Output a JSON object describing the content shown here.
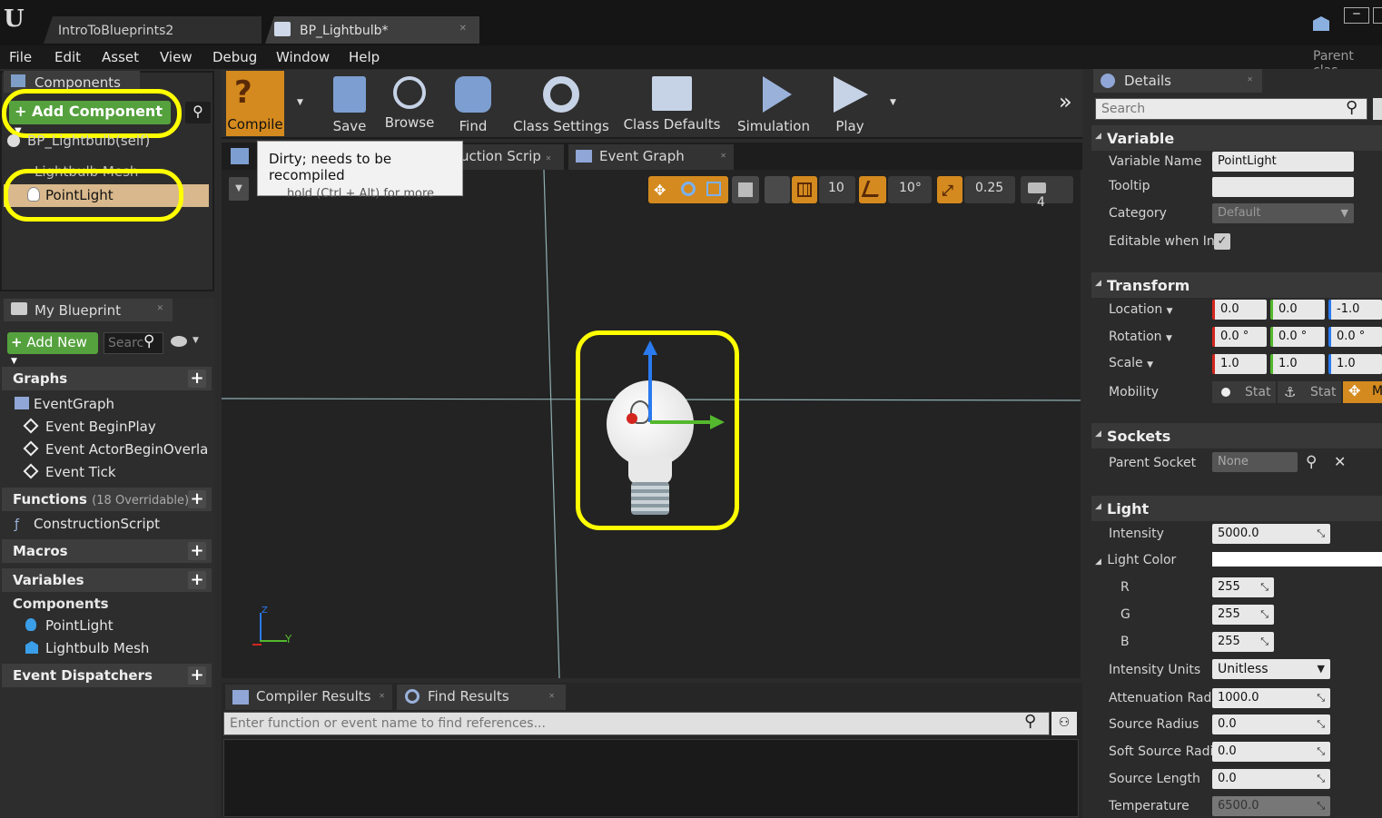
{
  "window": {
    "tabs": [
      "IntroToBlueprints2",
      "BP_Lightbulb*"
    ],
    "parent_class": "Parent clas",
    "logo": "U"
  },
  "menu": [
    "File",
    "Edit",
    "Asset",
    "View",
    "Debug",
    "Window",
    "Help"
  ],
  "components": {
    "title": "Components",
    "add_button": "+ Add Component",
    "self_item": "BP_Lightbulb(self)",
    "mesh_item": "Lightbulb Mesh",
    "selected_item": "PointLight"
  },
  "toolbar": {
    "items": [
      "Compile",
      "Save",
      "Browse",
      "Find",
      "Class Settings",
      "Class Defaults",
      "Simulation",
      "Play"
    ]
  },
  "tooltip": {
    "title": "Dirty; needs to be recompiled",
    "subtitle": "hold (Ctrl + Alt) for more"
  },
  "editor_tabs": [
    "uction Scrip",
    "Event Graph"
  ],
  "viewport": {
    "grid_snap": "10",
    "rotation_snap": "10°",
    "scale_snap": "0.25",
    "camera_speed": "4",
    "axis_y": "Y",
    "axis_z": "Z"
  },
  "my_blueprint": {
    "title": "My Blueprint",
    "add_new": "Add New",
    "search_placeholder": "Searc",
    "sections": {
      "graphs": "Graphs",
      "functions": "Functions",
      "functions_count": "(18 Overridable)",
      "macros": "Macros",
      "variables": "Variables",
      "components": "Components",
      "event_dispatchers": "Event Dispatchers"
    },
    "graph_items": [
      "EventGraph",
      "Event BeginPlay",
      "Event ActorBeginOverla",
      "Event Tick"
    ],
    "function_items": [
      "ConstructionScript"
    ],
    "component_items": [
      "PointLight",
      "Lightbulb Mesh"
    ]
  },
  "bottom": {
    "tabs": [
      "Compiler Results",
      "Find Results"
    ],
    "find_placeholder": "Enter function or event name to find references..."
  },
  "details": {
    "title": "Details",
    "search_placeholder": "Search",
    "variable": {
      "section": "Variable",
      "name_label": "Variable Name",
      "name_value": "PointLight",
      "tooltip_label": "Tooltip",
      "category_label": "Category",
      "category_value": "Default",
      "editable_label": "Editable when Inl"
    },
    "transform": {
      "section": "Transform",
      "location_label": "Location",
      "location": [
        "0.0",
        "0.0",
        "-1.0"
      ],
      "rotation_label": "Rotation",
      "rotation": [
        "0.0 °",
        "0.0 °",
        "0.0 °"
      ],
      "scale_label": "Scale",
      "scale": [
        "1.0",
        "1.0",
        "1.0"
      ],
      "mobility_label": "Mobility",
      "mobility_options": [
        "Stat",
        "Stat",
        "M"
      ]
    },
    "sockets": {
      "section": "Sockets",
      "parent_label": "Parent Socket",
      "parent_value": "None"
    },
    "light": {
      "section": "Light",
      "intensity_label": "Intensity",
      "intensity": "5000.0",
      "color_label": "Light Color",
      "r_label": "R",
      "r": "255",
      "g_label": "G",
      "g": "255",
      "b_label": "B",
      "b": "255",
      "units_label": "Intensity Units",
      "units": "Unitless",
      "atten_label": "Attenuation Radi",
      "atten": "1000.0",
      "src_radius_label": "Source Radius",
      "src_radius": "0.0",
      "soft_label": "Soft Source Radi",
      "soft": "0.0",
      "src_len_label": "Source Length",
      "src_len": "0.0",
      "temp_label": "Temperature",
      "temp": "6500.0"
    }
  },
  "colors": {
    "highlight": "#ffff00",
    "accent_orange": "#d48a1e",
    "add_green": "#55a13e",
    "selected_row": "#d8b88c"
  }
}
